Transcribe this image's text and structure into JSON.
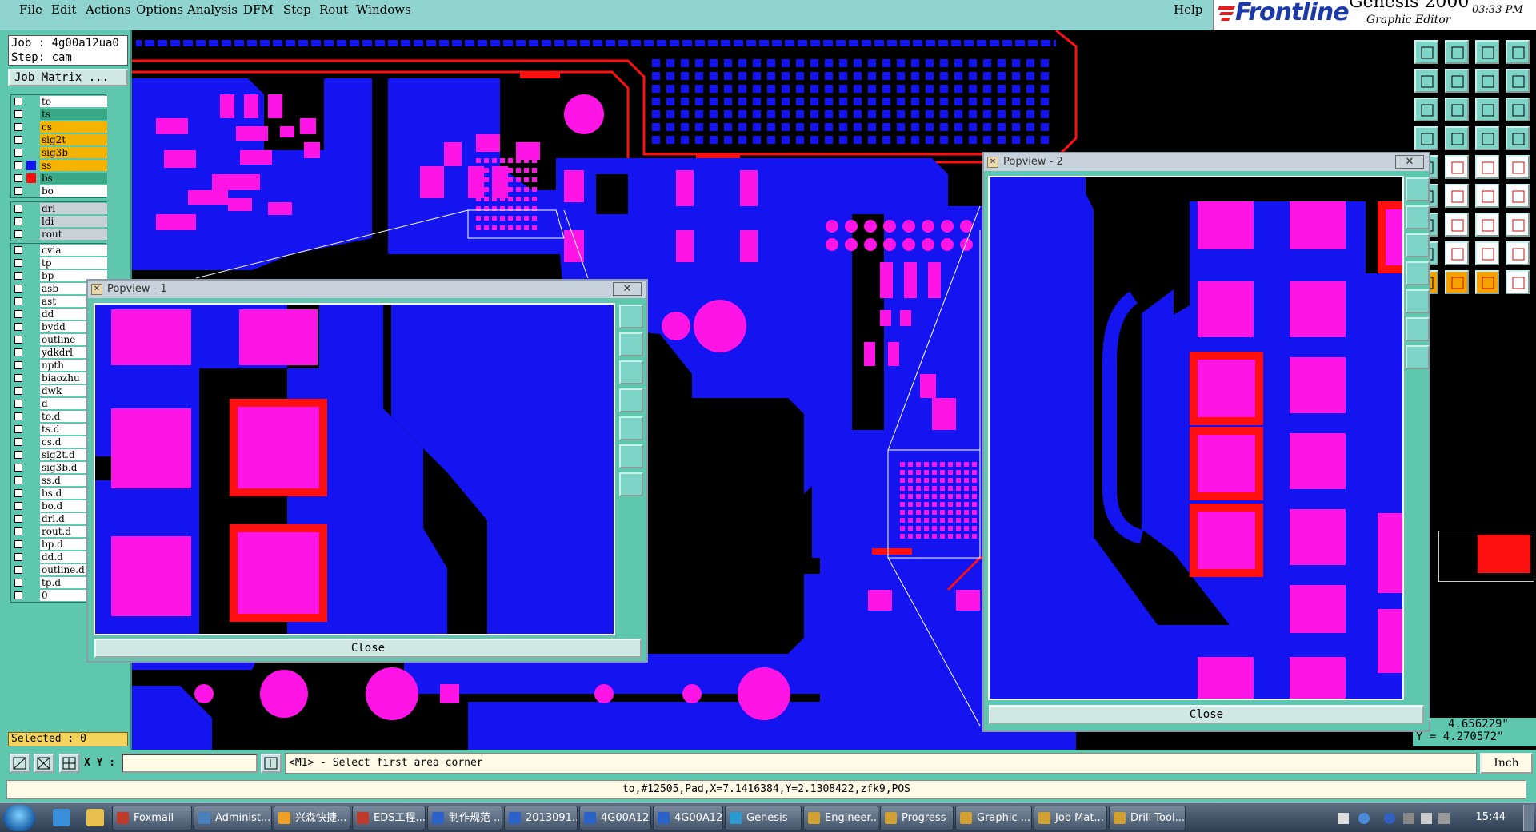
{
  "menu": {
    "items": [
      "File",
      "Edit",
      "Actions",
      "Options",
      "Analysis",
      "DFM",
      "Step",
      "Rout",
      "Windows"
    ],
    "help": "Help"
  },
  "brand": {
    "logo": "Frontline",
    "product": "Genesis 2000",
    "subtitle": "Graphic Editor",
    "date": "",
    "time": "03:33 PM"
  },
  "job": {
    "job_line": "Job : 4g00a12ua0",
    "step_line": "Step: cam",
    "matrix_button": "Job Matrix ..."
  },
  "layers_group1": [
    {
      "name": "to",
      "color": "#ffffff",
      "mark": "none"
    },
    {
      "name": "ts",
      "color": "#3aa884",
      "mark": "none"
    },
    {
      "name": "cs",
      "color": "#f5b400",
      "mark": "none"
    },
    {
      "name": "sig2t",
      "color": "#f5b400",
      "mark": "none"
    },
    {
      "name": "sig3b",
      "color": "#f5b400",
      "mark": "none"
    },
    {
      "name": "ss",
      "color": "#f5b400",
      "mark": "blue"
    },
    {
      "name": "bs",
      "color": "#3aa884",
      "mark": "red"
    },
    {
      "name": "bo",
      "color": "#ffffff",
      "mark": "none"
    }
  ],
  "layers_group2": [
    {
      "name": "drl",
      "color": "#c8d2d6",
      "mark": "none"
    },
    {
      "name": "ldi",
      "color": "#c8d2d6",
      "mark": "none"
    },
    {
      "name": "rout",
      "color": "#c8d2d6",
      "mark": "none"
    }
  ],
  "layers_group3": [
    {
      "name": "cvia"
    },
    {
      "name": "tp"
    },
    {
      "name": "bp"
    },
    {
      "name": "asb"
    },
    {
      "name": "ast"
    },
    {
      "name": "dd"
    },
    {
      "name": "bydd"
    },
    {
      "name": "outline"
    },
    {
      "name": "ydkdrl"
    },
    {
      "name": "npth"
    },
    {
      "name": "biaozhu"
    },
    {
      "name": "dwk"
    },
    {
      "name": "d"
    },
    {
      "name": "to.d"
    },
    {
      "name": "ts.d"
    },
    {
      "name": "cs.d"
    },
    {
      "name": "sig2t.d"
    },
    {
      "name": "sig3b.d"
    },
    {
      "name": "ss.d"
    },
    {
      "name": "bs.d"
    },
    {
      "name": "bo.d"
    },
    {
      "name": "drl.d"
    },
    {
      "name": "rout.d"
    },
    {
      "name": "bp.d"
    },
    {
      "name": "dd.d"
    },
    {
      "name": "outline.d"
    },
    {
      "name": "tp.d"
    },
    {
      "name": "0"
    }
  ],
  "selected": "Selected : 0",
  "popview1": {
    "title": "Popview - 1",
    "close_x": "✕",
    "close_button": "Close"
  },
  "popview2": {
    "title": "Popview - 2",
    "close_x": "✕",
    "close_button": "Close"
  },
  "coords": {
    "x": "4.656229\"",
    "y": "Y = 4.270572\""
  },
  "prompt": {
    "xy_label": "X Y :",
    "message": "<M1> - Select first area corner",
    "unit": "Inch"
  },
  "status": "to,#12505,Pad,X=7.1416384,Y=2.1308422,zfk9,POS",
  "taskbar": {
    "tasks": [
      {
        "label": "Foxmail",
        "color": "#c0392b"
      },
      {
        "label": "Administ...",
        "color": "#4a7fc0"
      },
      {
        "label": "兴森快捷...",
        "color": "#f0a020"
      },
      {
        "label": "EDS工程...",
        "color": "#c0392b"
      },
      {
        "label": "制作规范 ...",
        "color": "#2a62c9"
      },
      {
        "label": "2013091...",
        "color": "#2a62c9"
      },
      {
        "label": "4G00A12...",
        "color": "#2a62c9"
      },
      {
        "label": "4G00A12...",
        "color": "#2a62c9"
      },
      {
        "label": "Genesis",
        "color": "#2a9ad0"
      },
      {
        "label": "Engineer...",
        "color": "#d0a030"
      },
      {
        "label": "Progress",
        "color": "#d0a030"
      },
      {
        "label": "Graphic ...",
        "color": "#d0a030"
      },
      {
        "label": "Job Mat...",
        "color": "#d0a030"
      },
      {
        "label": "Drill Tool...",
        "color": "#d0a030"
      }
    ],
    "clock": "15:44"
  },
  "colors": {
    "copper": "#1414f0",
    "pad": "#ff14e6",
    "outline": "#ff0000",
    "panel": "#5ec7ad"
  }
}
